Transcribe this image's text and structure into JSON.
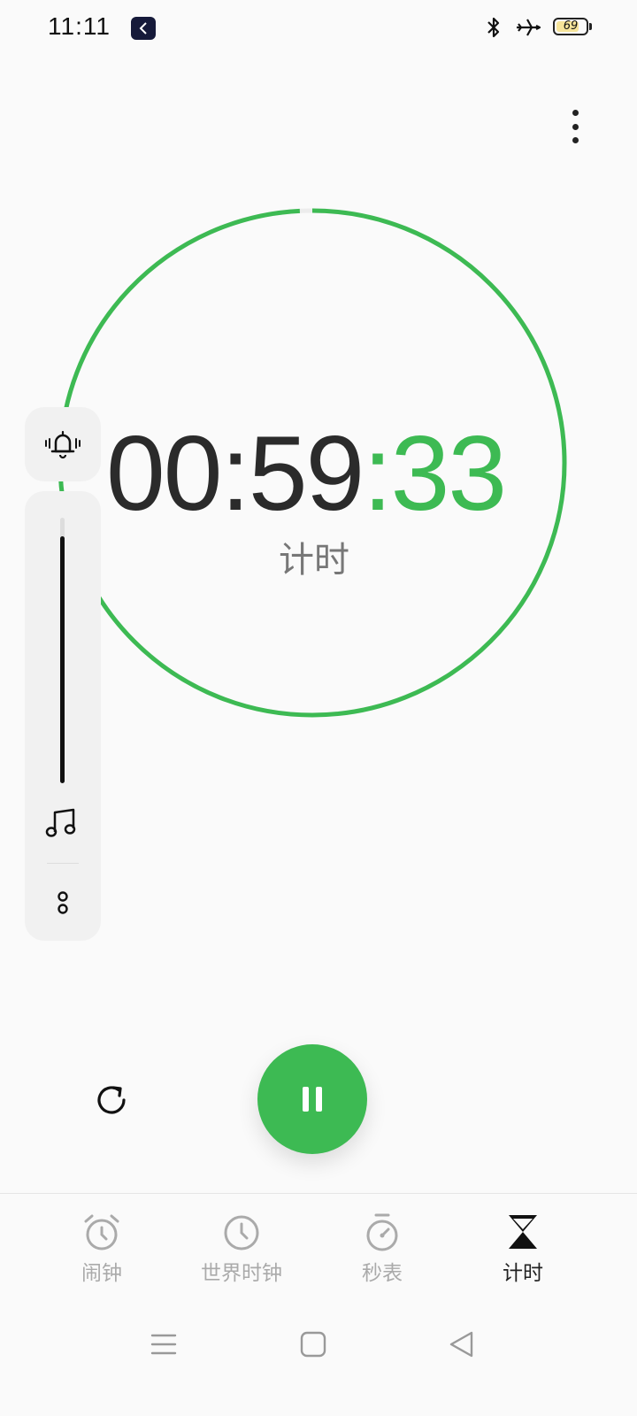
{
  "status_bar": {
    "time": "11:11",
    "battery_level": "69",
    "icons": [
      "bluetooth-icon",
      "airplane-mode-icon",
      "battery-icon"
    ]
  },
  "menu": {
    "icon": "more-vertical-icon"
  },
  "timer": {
    "hours_minutes": "00:59",
    "seconds": ":33",
    "label": "计时",
    "remaining_fraction": 0.992,
    "accent_color": "#3dba53"
  },
  "side_panel": {
    "alarm_icon": "bell-ringing-icon",
    "volume_level": 0.93,
    "music_icon": "music-note-icon",
    "options_icon": "options-icon"
  },
  "controls": {
    "reset_icon": "reset-icon",
    "pause_icon": "pause-icon"
  },
  "bottom_nav": {
    "items": [
      {
        "label": "闹钟",
        "icon": "alarm-clock-icon",
        "active": false
      },
      {
        "label": "世界时钟",
        "icon": "world-clock-icon",
        "active": false
      },
      {
        "label": "秒表",
        "icon": "stopwatch-icon",
        "active": false
      },
      {
        "label": "计时",
        "icon": "hourglass-icon",
        "active": true
      }
    ]
  },
  "system_nav": [
    "menu-icon",
    "home-icon",
    "back-icon"
  ]
}
